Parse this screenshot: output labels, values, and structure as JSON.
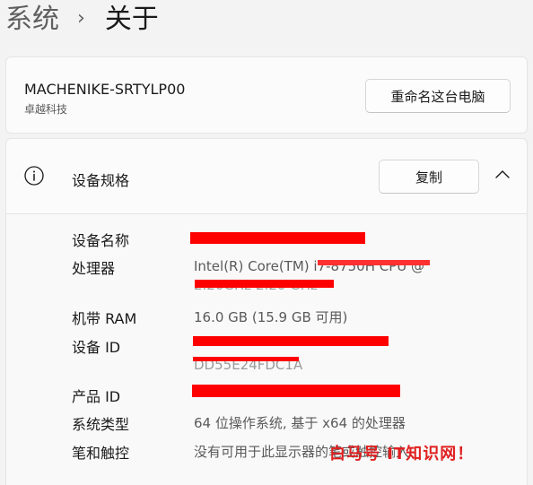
{
  "breadcrumb": {
    "parent": "系统",
    "separator": "›",
    "current": "关于"
  },
  "device": {
    "name": "MACHENIKE-SRTYLP00",
    "subtitle": "卓越科技",
    "rename_label": "重命名这台电脑"
  },
  "specs": {
    "title": "设备规格",
    "copy_label": "复制",
    "rows": [
      {
        "label": "设备名称",
        "value": ""
      },
      {
        "label": "处理器",
        "value": "Intel(R) Core(TM) i7-8750H CPU @",
        "value2": "2.20GHz   2.20 GHz"
      },
      {
        "label": "机带 RAM",
        "value": "16.0 GB (15.9 GB 可用)"
      },
      {
        "label": "设备 ID",
        "value": "",
        "value2": "DD55E24FDC1A"
      },
      {
        "label": "产品 ID",
        "value": ""
      },
      {
        "label": "系统类型",
        "value": "64 位操作系统, 基于 x64 的处理器"
      },
      {
        "label": "笔和触控",
        "value": "没有可用于此显示器的笔或触控输入"
      }
    ]
  },
  "watermark": {
    "text": "白马号 IT知识网！"
  },
  "icons": {
    "info": "info-circle-icon",
    "collapse": "chevron-up-icon",
    "separator": "chevron-right-icon"
  },
  "colors": {
    "background": "#f3f3f3",
    "card": "#fbfbfb",
    "redaction": "#ff0000"
  }
}
